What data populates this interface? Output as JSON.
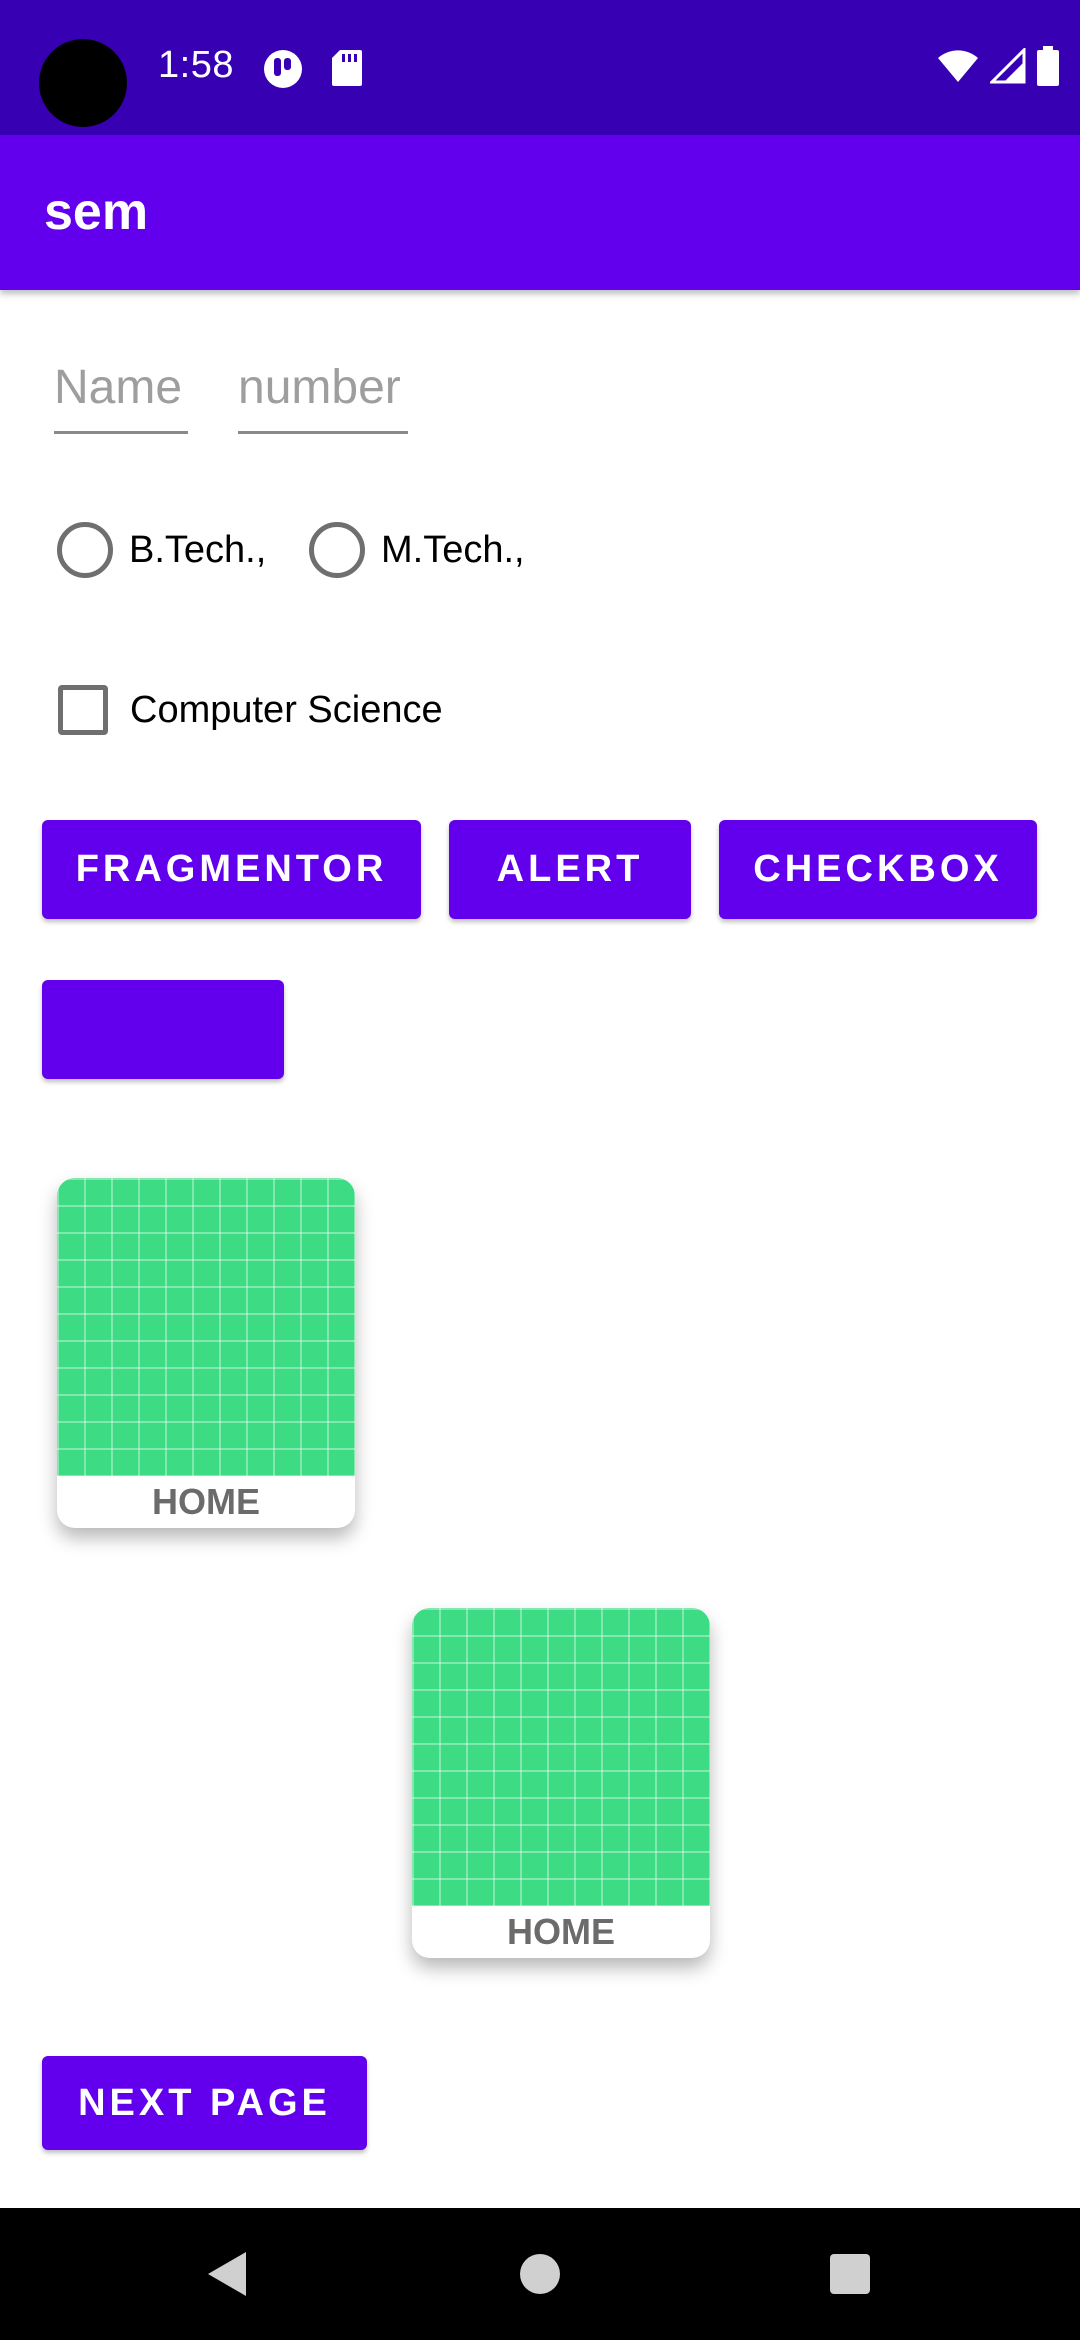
{
  "status_bar": {
    "time": "1:58"
  },
  "app_bar": {
    "title": "sem"
  },
  "inputs": {
    "name_placeholder": "Name",
    "number_placeholder": "number"
  },
  "radios": [
    {
      "label": "B.Tech.,"
    },
    {
      "label": "M.Tech.,"
    }
  ],
  "checkbox": {
    "label": "Computer Science",
    "checked": false
  },
  "buttons": {
    "fragmentor": "FRAGMENTOR",
    "alert": "ALERT",
    "checkbox": "CHECKBOX",
    "blank": "",
    "next_page": "NEXT PAGE"
  },
  "cards": [
    {
      "label": "HOME"
    },
    {
      "label": "HOME"
    }
  ],
  "colors": {
    "primary": "#6200EE",
    "primary_dark": "#3700B3",
    "android_green": "#3DDC84"
  }
}
